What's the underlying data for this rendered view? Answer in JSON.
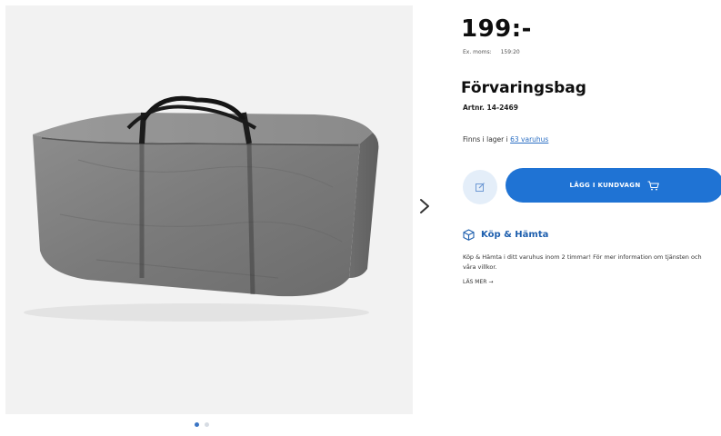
{
  "product": {
    "price": "199:-",
    "ex_moms_label": "Ex. moms:",
    "ex_moms_value": "159:20",
    "title": "Förvaringsbag",
    "artnr": "Artnr. 14-2469",
    "stock_prefix": "Finns i lager i",
    "stock_link": "63 varuhus"
  },
  "actions": {
    "add_to_cart": "LÄGG I KUNDVAGN",
    "edit_icon": "edit-icon",
    "cart_icon": "cart-icon"
  },
  "kop_hamta": {
    "heading": "Köp & Hämta",
    "description": "Köp & Hämta i ditt varuhus inom 2 timmar! För mer information om tjänsten och våra villkor.",
    "read_more": "LÄS MER →"
  },
  "gallery": {
    "image_count": 2,
    "active_index": 0,
    "next_icon": "chevron-right-icon"
  },
  "colors": {
    "accent": "#1f73d4",
    "link": "#2b6fc4",
    "heading_blue": "#1e5fae",
    "edit_bg": "#e4eef9"
  }
}
